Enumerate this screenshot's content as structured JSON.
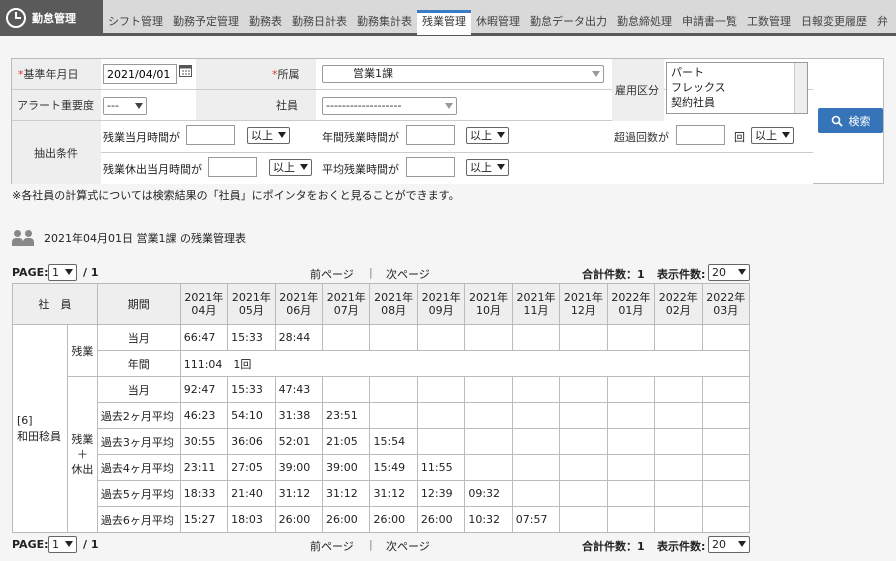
{
  "app": {
    "title": "勤怠管理"
  },
  "nav": {
    "tabs": [
      "シフト管理",
      "勤務予定管理",
      "勤務表",
      "勤務日計表",
      "勤務集計表",
      "残業管理",
      "休暇管理",
      "勤怠データ出力",
      "勤怠締処理",
      "申請書一覧",
      "工数管理",
      "日報変更履歴",
      "弁"
    ],
    "active_index": 5
  },
  "form": {
    "base_date_label": "基準年月日",
    "base_date_value": "2021/04/01",
    "dept_label": "所属",
    "dept_value": "営業1課",
    "employment_label": "雇用区分",
    "employment_options": [
      "パート",
      "フレックス",
      "契約社員"
    ],
    "alert_label": "アラート重要度",
    "alert_value": "---",
    "employee_label": "社員",
    "employee_value": "-------------------",
    "extract_label": "抽出条件",
    "cond1_label": "残業当月時間が",
    "cond1_op": "以上",
    "cond2_label": "年間残業時間が",
    "cond2_op": "以上",
    "cond3_label": "超過回数が",
    "cond3_unit": "回",
    "cond3_op": "以上",
    "cond4_label": "残業休出当月時間が",
    "cond4_op": "以上",
    "cond5_label": "平均残業時間が",
    "cond5_op": "以上",
    "search_label": "検索"
  },
  "note": "※各社員の計算式については検索結果の「社員」にポインタをおくと見ることができます。",
  "result_title": "2021年04月01日 営業1課 の残業管理表",
  "pager": {
    "page_label": "PAGE:",
    "page_value": "1",
    "total_pages": "/ 1",
    "prev": "前ページ",
    "sep": "|",
    "next": "次ページ",
    "count_label": "合計件数：1",
    "display_label": "表示件数:",
    "display_value": "20"
  },
  "table": {
    "h_employee": "社　員",
    "h_period": "期間",
    "months": [
      [
        "2021年",
        "04月"
      ],
      [
        "2021年",
        "05月"
      ],
      [
        "2021年",
        "06月"
      ],
      [
        "2021年",
        "07月"
      ],
      [
        "2021年",
        "08月"
      ],
      [
        "2021年",
        "09月"
      ],
      [
        "2021年",
        "10月"
      ],
      [
        "2021年",
        "11月"
      ],
      [
        "2021年",
        "12月"
      ],
      [
        "2022年",
        "01月"
      ],
      [
        "2022年",
        "02月"
      ],
      [
        "2022年",
        "03月"
      ]
    ],
    "employee_id": "[6]",
    "employee_name": "和田稔員",
    "group1": "残業",
    "group2_a": "残業",
    "group2_b": "＋",
    "group2_c": "休出",
    "rows": [
      {
        "label": "当月",
        "cells": [
          "66:47",
          "15:33",
          "28:44",
          "",
          "",
          "",
          "",
          "",
          "",
          "",
          "",
          ""
        ]
      },
      {
        "label": "年間",
        "span": "111:04　1回"
      },
      {
        "label": "当月",
        "cells": [
          "92:47",
          "15:33",
          "47:43",
          "",
          "",
          "",
          "",
          "",
          "",
          "",
          "",
          ""
        ]
      },
      {
        "label": "過去2ヶ月平均",
        "cells": [
          "46:23",
          "54:10",
          "31:38",
          "23:51",
          "",
          "",
          "",
          "",
          "",
          "",
          "",
          ""
        ]
      },
      {
        "label": "過去3ヶ月平均",
        "cells": [
          "30:55",
          "36:06",
          "52:01",
          "21:05",
          "15:54",
          "",
          "",
          "",
          "",
          "",
          "",
          ""
        ]
      },
      {
        "label": "過去4ヶ月平均",
        "cells": [
          "23:11",
          "27:05",
          "39:00",
          "39:00",
          "15:49",
          "11:55",
          "",
          "",
          "",
          "",
          "",
          ""
        ]
      },
      {
        "label": "過去5ヶ月平均",
        "cells": [
          "18:33",
          "21:40",
          "31:12",
          "31:12",
          "31:12",
          "12:39",
          "09:32",
          "",
          "",
          "",
          "",
          ""
        ]
      },
      {
        "label": "過去6ヶ月平均",
        "cells": [
          "15:27",
          "18:03",
          "26:00",
          "26:00",
          "26:00",
          "26:00",
          "10:32",
          "07:57",
          "",
          "",
          "",
          ""
        ]
      }
    ]
  }
}
